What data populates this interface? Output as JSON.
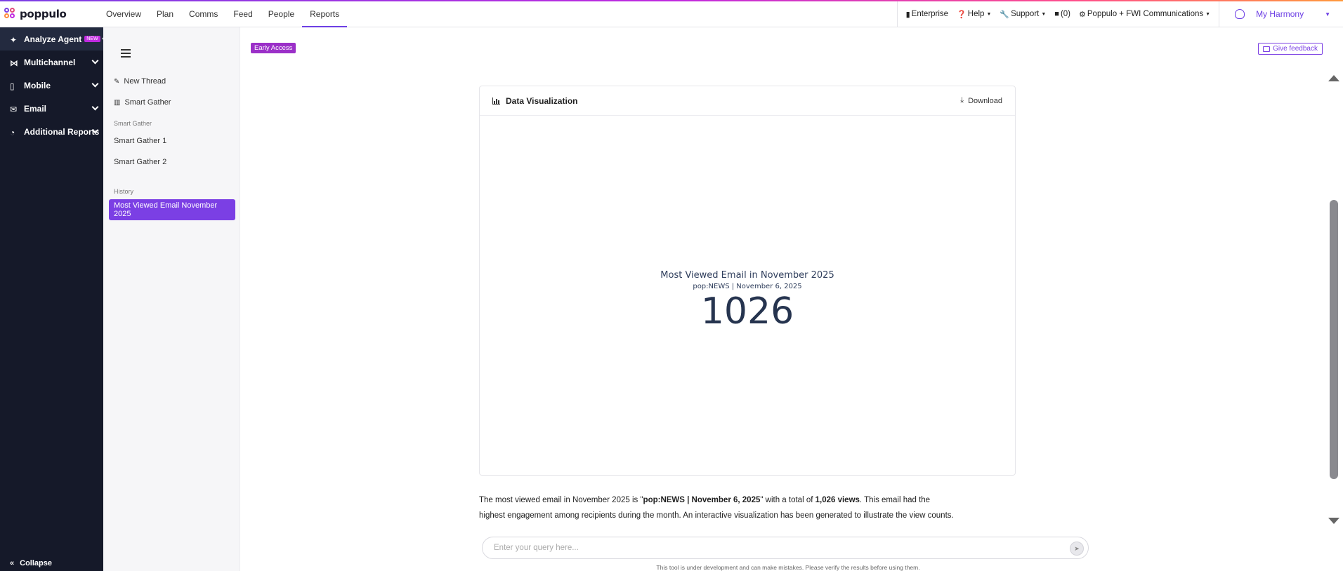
{
  "brand": {
    "logo_text": "poppulo"
  },
  "topnav": {
    "tabs": [
      {
        "label": "Overview"
      },
      {
        "label": "Plan"
      },
      {
        "label": "Comms"
      },
      {
        "label": "Feed"
      },
      {
        "label": "People"
      },
      {
        "label": "Reports",
        "active": true
      }
    ],
    "right": {
      "enterprise": "Enterprise",
      "help": "Help",
      "support": "Support",
      "notifications": "(0)",
      "org": "Poppulo + FWI Communications",
      "user": "My Harmony"
    }
  },
  "sidebar": {
    "items": [
      {
        "label": "Analyze Agent",
        "badge": "NEW",
        "active": true
      },
      {
        "label": "Multichannel"
      },
      {
        "label": "Mobile"
      },
      {
        "label": "Email"
      },
      {
        "label": "Additional Reports"
      }
    ],
    "collapse_label": "Collapse"
  },
  "panel": {
    "new_thread": "New Thread",
    "smart_gather": "Smart Gather",
    "section_smart_gather": "Smart Gather",
    "smart_gather_1": "Smart Gather 1",
    "smart_gather_2": "Smart Gather 2",
    "section_history": "History",
    "history_active": "Most Viewed Email November 2025"
  },
  "main": {
    "early_access": "Early Access",
    "give_feedback": "Give feedback",
    "card": {
      "title": "Data Visualization",
      "download": "Download",
      "viz_title": "Most Viewed Email in November 2025",
      "viz_subtitle": "pop:NEWS | November 6, 2025",
      "viz_value": "1026"
    },
    "answer": {
      "p1": "The most viewed email in November 2025 is \"",
      "email_name": "pop:NEWS | November 6, 2025",
      "p2": "\" with a total of ",
      "views": "1,026 views",
      "p3": ". This email had the highest engagement among recipients during the month. An interactive visualization has been generated to illustrate the view counts."
    },
    "query_placeholder": "Enter your query here...",
    "disclaimer": "This tool is under development and can make mistakes. Please verify the results before using them."
  },
  "colors": {
    "accent": "#7b3fe4",
    "sidebar_bg": "#151929",
    "badge": "#c02ae0"
  }
}
